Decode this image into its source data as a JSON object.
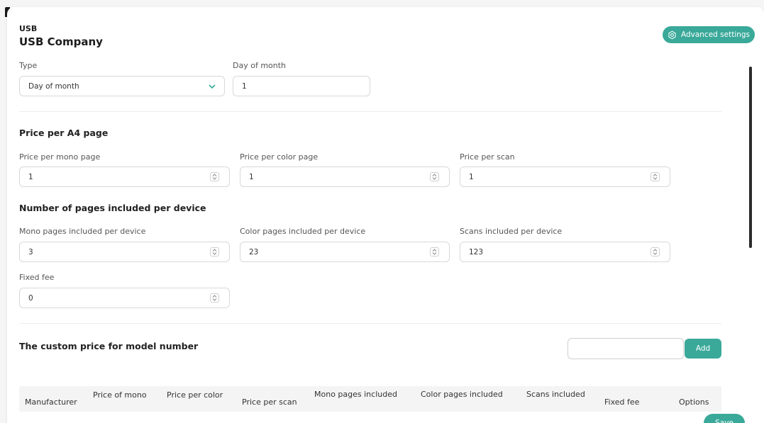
{
  "header": {
    "subtitle": "USB",
    "title": "USB Company"
  },
  "advanced_settings": {
    "label": "Advanced settings",
    "icon": "settings-gear-icon"
  },
  "billing": {
    "type_label": "Type",
    "type_value": "Day of month",
    "day_label": "Day of month",
    "day_value": "1"
  },
  "price_per_page": {
    "heading": "Price per A4 page",
    "mono_label": "Price per mono page",
    "mono_value": "1",
    "color_label": "Price per color page",
    "color_value": "1",
    "scan_label": "Price per scan",
    "scan_value": "1"
  },
  "pages_included": {
    "heading": "Number of pages included per device",
    "mono_label": "Mono pages included per device",
    "mono_value": "3",
    "color_label": "Color pages included per device",
    "color_value": "23",
    "scan_label": "Scans included per device",
    "scan_value": "123",
    "fee_label": "Fixed fee",
    "fee_value": "0"
  },
  "custom_price": {
    "heading": "The custom price for model number",
    "input_value": "",
    "add_label": "Add"
  },
  "table": {
    "columns": [
      "Manufacturer",
      "Price of mono",
      "Price per color",
      "Price per scan",
      "Mono pages included",
      "Color pages included",
      "Scans included",
      "Fixed fee",
      "Options"
    ]
  },
  "save_label": "Save",
  "colors": {
    "accent": "#3aa99a",
    "scroll": "#2b2b2b"
  }
}
